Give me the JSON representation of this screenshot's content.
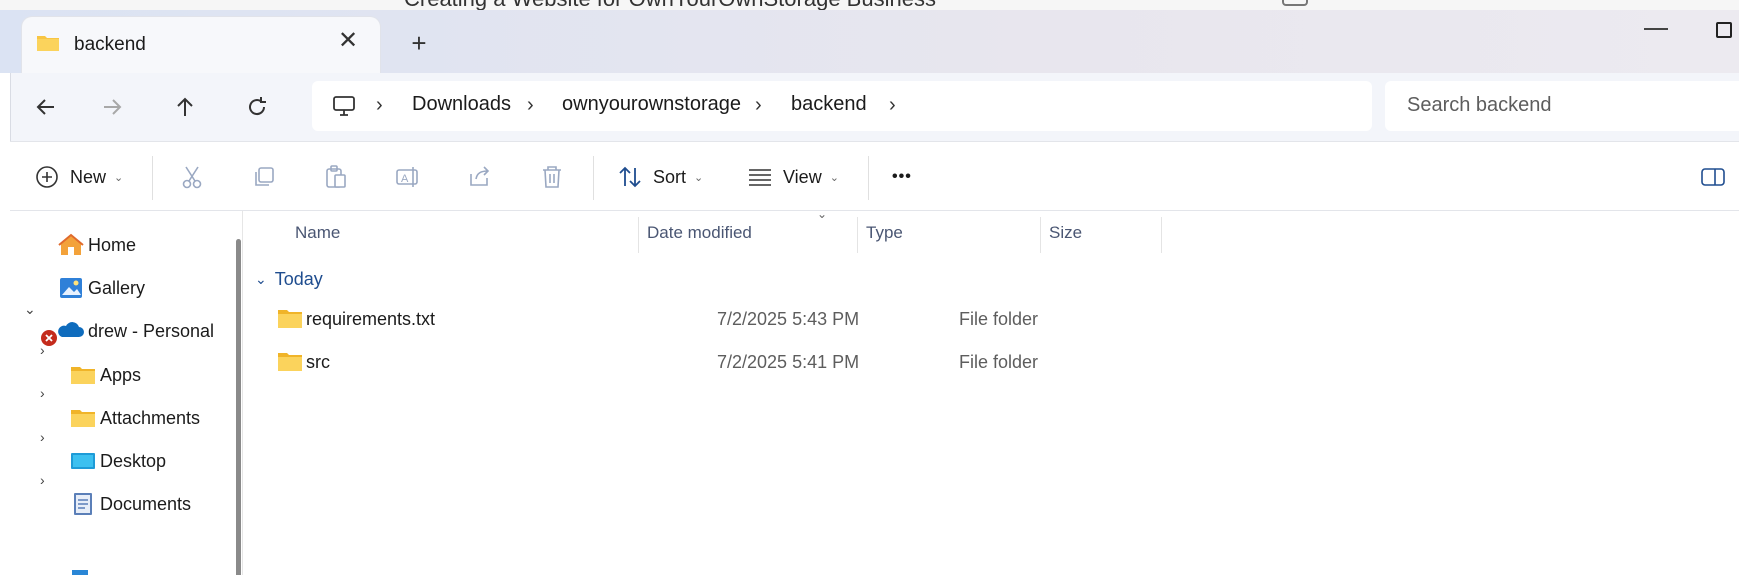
{
  "background_window": {
    "title": "Creating a Website for OwnYourOwnStorage Business"
  },
  "tab": {
    "title": "backend",
    "close_glyph": "✕",
    "new_tab_glyph": "+"
  },
  "breadcrumb": {
    "items": [
      "Downloads",
      "ownyourownstorage",
      "backend"
    ],
    "separator": "›"
  },
  "search": {
    "placeholder": "Search backend"
  },
  "commands": {
    "new_label": "New",
    "sort_label": "Sort",
    "view_label": "View",
    "more_glyph": "•••"
  },
  "sidebar": {
    "items": [
      {
        "label": "Home",
        "icon": "home-icon"
      },
      {
        "label": "Gallery",
        "icon": "gallery-icon"
      },
      {
        "label": "drew - Personal",
        "icon": "onedrive-cloud-icon",
        "status": "error"
      },
      {
        "label": "Apps",
        "icon": "folder-icon"
      },
      {
        "label": "Attachments",
        "icon": "folder-icon"
      },
      {
        "label": "Desktop",
        "icon": "desktop-icon"
      },
      {
        "label": "Documents",
        "icon": "documents-icon"
      }
    ]
  },
  "file_list": {
    "columns": {
      "name": "Name",
      "date_modified": "Date modified",
      "type": "Type",
      "size": "Size"
    },
    "groups": [
      {
        "label": "Today",
        "rows": [
          {
            "name": "requirements.txt",
            "date_modified": "7/2/2025 5:43 PM",
            "type": "File folder",
            "size": ""
          },
          {
            "name": "src",
            "date_modified": "7/2/2025 5:41 PM",
            "type": "File folder",
            "size": ""
          }
        ]
      }
    ]
  },
  "colors": {
    "accent": "#1f4d8f",
    "folder": "#f8c543",
    "error": "#c42b1c",
    "onedrive": "#0f6cbd"
  }
}
